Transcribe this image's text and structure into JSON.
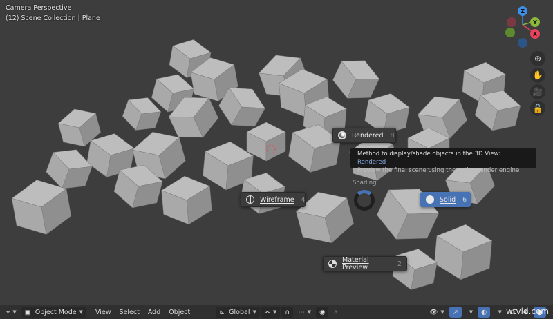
{
  "viewport": {
    "hud": {
      "view_name": "Camera Perspective",
      "collection_line": "(12) Scene Collection | Plane"
    },
    "gizmo": {
      "axes": [
        "Z",
        "Y",
        "X"
      ],
      "colors": {
        "x": "#e8435a",
        "y": "#8cb83a",
        "z": "#3d8ee6"
      }
    },
    "nav_buttons": [
      "zoom-icon",
      "hand-pan-icon",
      "camera-icon",
      "unlock-icon"
    ]
  },
  "pie_menu": {
    "title": "Shading",
    "items": [
      {
        "label": "Rendered",
        "key": "8",
        "icon": "rendered-shading-icon",
        "active": false
      },
      {
        "label": "Wireframe",
        "key": "4",
        "icon": "wireframe-shading-icon",
        "active": false
      },
      {
        "label": "Solid",
        "key": "6",
        "icon": "solid-shading-icon",
        "active": true
      },
      {
        "label": "Material Preview",
        "key": "2",
        "icon": "material-preview-icon",
        "active": false
      }
    ],
    "accent": "#4772b3"
  },
  "tooltip": {
    "prefix": "Method to display/shade objects in the 3D View: ",
    "value": "Rendered",
    "description": "Preview the final scene using the active render engine"
  },
  "header": {
    "mode": "Object Mode",
    "menus": [
      "View",
      "Select",
      "Add",
      "Object"
    ],
    "orientation": "Global"
  },
  "watermark": "wtvid.com"
}
